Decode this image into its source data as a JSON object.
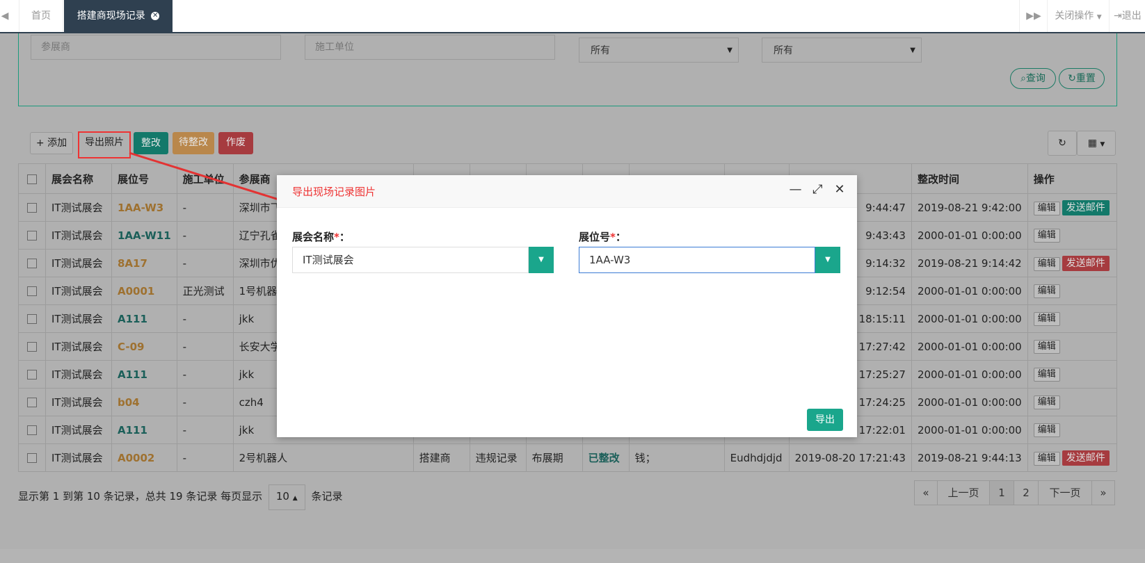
{
  "topbar": {
    "home_tab": "首页",
    "active_tab": "搭建商现场记录",
    "close_ops": "关闭操作",
    "logout": "退出"
  },
  "search": {
    "exhibitor_placeholder": "参展商",
    "constructor_placeholder": "施工单位",
    "select1_value": "所有",
    "select2_value": "所有",
    "query_label": "查询",
    "reset_label": "重置"
  },
  "toolbar": {
    "add_label": "添加",
    "export_label": "导出照片",
    "rectify_label": "整改",
    "pending_label": "待整改",
    "void_label": "作废"
  },
  "table": {
    "headers": [
      "展会名称",
      "展位号",
      "施工单位",
      "参展商",
      "",
      "",
      "",
      "",
      "",
      "",
      "",
      "整改时间",
      "操作"
    ],
    "rows": [
      {
        "expo": "IT测试展会",
        "booth": "1AA-W3",
        "booth_color": "orange",
        "unit": "-",
        "exhibitor": "深圳市飞",
        "time1": "9:44:47",
        "time2": "2019-08-21 9:42:00",
        "mail": "green"
      },
      {
        "expo": "IT测试展会",
        "booth": "1AA-W11",
        "booth_color": "green",
        "unit": "-",
        "exhibitor": "辽宁孔雀",
        "time1": "9:43:43",
        "time2": "2000-01-01 0:00:00",
        "mail": ""
      },
      {
        "expo": "IT测试展会",
        "booth": "8A17",
        "booth_color": "orange",
        "unit": "-",
        "exhibitor": "深圳市优",
        "time1": "9:14:32",
        "time2": "2019-08-21 9:14:42",
        "mail": "red"
      },
      {
        "expo": "IT测试展会",
        "booth": "A0001",
        "booth_color": "orange",
        "unit": "正光测试",
        "exhibitor": "1号机器人",
        "time1": "9:12:54",
        "time2": "2000-01-01 0:00:00",
        "mail": ""
      },
      {
        "expo": "IT测试展会",
        "booth": "A111",
        "booth_color": "green",
        "unit": "-",
        "exhibitor": "jkk",
        "time1": "0 18:15:11",
        "time2": "2000-01-01 0:00:00",
        "mail": ""
      },
      {
        "expo": "IT测试展会",
        "booth": "C-09",
        "booth_color": "orange",
        "unit": "-",
        "exhibitor": "长安大学",
        "time1": "0 17:27:42",
        "time2": "2000-01-01 0:00:00",
        "mail": ""
      },
      {
        "expo": "IT测试展会",
        "booth": "A111",
        "booth_color": "green",
        "unit": "-",
        "exhibitor": "jkk",
        "time1": "0 17:25:27",
        "time2": "2000-01-01 0:00:00",
        "mail": ""
      },
      {
        "expo": "IT测试展会",
        "booth": "b04",
        "booth_color": "orange",
        "unit": "-",
        "exhibitor": "czh4",
        "time1": "0 17:24:25",
        "time2": "2000-01-01 0:00:00",
        "mail": ""
      },
      {
        "expo": "IT测试展会",
        "booth": "A111",
        "booth_color": "green",
        "unit": "-",
        "exhibitor": "jkk",
        "time1": "0 17:22:01",
        "time2": "2000-01-01 0:00:00",
        "mail": ""
      }
    ],
    "last_row": {
      "expo": "IT测试展会",
      "booth": "A0002",
      "unit": "-",
      "exhibitor": "2号机器人",
      "c5": "搭建商",
      "c6": "违规记录",
      "c7": "布展期",
      "status": "已整改",
      "desc": "钱；",
      "person": "Eudhdjdjd",
      "time1": "2019-08-20 17:21:43",
      "time2": "2019-08-21 9:44:13"
    },
    "edit_label": "编辑",
    "mail_label": "发送邮件"
  },
  "footer": {
    "info_prefix": "显示第 1 到第 10 条记录，总共 19 条记录 每页显示",
    "page_size": "10",
    "info_suffix": "条记录",
    "first": "«",
    "prev": "上一页",
    "p1": "1",
    "p2": "2",
    "next": "下一页",
    "last": "»"
  },
  "modal": {
    "title": "导出现场记录图片",
    "expo_label": "展会名称",
    "expo_value": "IT测试展会",
    "booth_label": "展位号",
    "booth_value": "1AA-W3",
    "colon": "：",
    "star": "*",
    "export_label": "导出"
  },
  "colors": {
    "accent": "#1aa68c",
    "dark_tab": "#2f4050",
    "red": "#e33333"
  }
}
